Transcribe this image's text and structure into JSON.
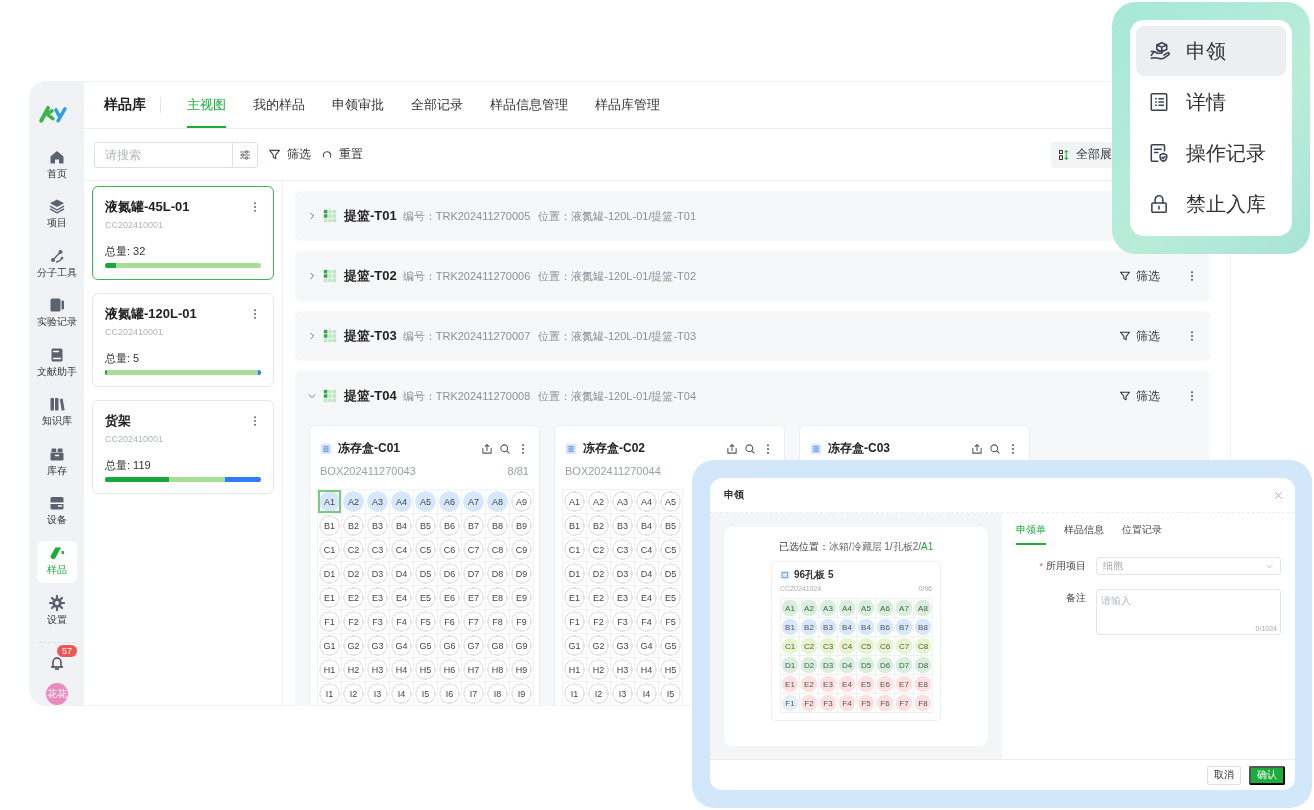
{
  "sidebar": {
    "items": [
      {
        "label": "首页",
        "selected": false
      },
      {
        "label": "项目",
        "selected": false
      },
      {
        "label": "分子工具",
        "selected": false
      },
      {
        "label": "实验记录",
        "selected": false
      },
      {
        "label": "文献助手",
        "selected": false
      },
      {
        "label": "知识库",
        "selected": false
      },
      {
        "label": "库存",
        "selected": false
      },
      {
        "label": "设备",
        "selected": false
      },
      {
        "label": "样品",
        "selected": true
      },
      {
        "label": "设置",
        "selected": false
      }
    ],
    "notification_count": "57",
    "avatar_text": "花花"
  },
  "header": {
    "title": "样品库",
    "tabs": [
      {
        "label": "主视图",
        "selected": true
      },
      {
        "label": "我的样品",
        "selected": false
      },
      {
        "label": "申领审批",
        "selected": false
      },
      {
        "label": "全部记录",
        "selected": false
      },
      {
        "label": "样品信息管理",
        "selected": false
      },
      {
        "label": "样品库管理",
        "selected": false
      }
    ]
  },
  "toolbar": {
    "search_placeholder": "请搜索",
    "filter_label": "筛选",
    "reset_label": "重置",
    "expand_all_label": "全部展"
  },
  "storage_units": [
    {
      "name": "液氮罐-45L-01",
      "code": "CC202410001",
      "total": "总量: 32",
      "selected": true,
      "bar": {
        "color": "#a7dd97",
        "fills": [
          {
            "level": 0.07,
            "color": "#19a83a"
          }
        ]
      }
    },
    {
      "name": "液氮罐-120L-01",
      "code": "CC202410001",
      "total": "总量: 5",
      "selected": false,
      "bar": {
        "color": "#2f7df6",
        "fills": [
          {
            "level": 0.98,
            "color": "#a7dd97"
          },
          {
            "level": 0.01,
            "color": "#19a83a"
          }
        ]
      }
    },
    {
      "name": "货架",
      "code": "CC202410001",
      "total": "总量: 119",
      "selected": false,
      "bar": {
        "color": "#2f7df6",
        "fills": [
          {
            "level": 0.77,
            "color": "#a7dd97"
          },
          {
            "level": 0.41,
            "color": "#19a83a"
          }
        ]
      }
    }
  ],
  "baskets": [
    {
      "name": "提篮-T01",
      "code": "编号：TRK202411270005",
      "location": "位置：液氮罐-120L-01/提篮-T01",
      "expanded": false
    },
    {
      "name": "提篮-T02",
      "code": "编号：TRK202411270006",
      "location": "位置：液氮罐-120L-01/提篮-T02",
      "expanded": false,
      "filter_label": "筛选"
    },
    {
      "name": "提篮-T03",
      "code": "编号：TRK202411270007",
      "location": "位置：液氮罐-120L-01/提篮-T03",
      "expanded": false,
      "filter_label": "筛选"
    },
    {
      "name": "提篮-T04",
      "code": "编号：TRK202411270008",
      "location": "位置：液氮罐-120L-01/提篮-T04",
      "expanded": true,
      "filter_label": "筛选",
      "boxes": [
        {
          "name": "冻存盒-C01",
          "code": "BOX202411270043",
          "count": "8/81",
          "rows": [
            [
              {
                "label": "A1",
                "occupied": true,
                "selected": true
              },
              {
                "label": "A2",
                "occupied": true,
                "selected": false
              },
              {
                "label": "A3",
                "occupied": true,
                "selected": false
              },
              {
                "label": "A4",
                "occupied": true,
                "selected": false
              },
              {
                "label": "A5",
                "occupied": true,
                "selected": false
              },
              {
                "label": "A6",
                "occupied": true,
                "selected": false
              },
              {
                "label": "A7",
                "occupied": true,
                "selected": false
              },
              {
                "label": "A8",
                "occupied": true,
                "selected": false
              },
              {
                "label": "A9",
                "occupied": false,
                "selected": false
              }
            ],
            [
              {
                "label": "B1",
                "occupied": false,
                "selected": false
              },
              {
                "label": "B2",
                "occupied": false,
                "selected": false
              },
              {
                "label": "B3",
                "occupied": false,
                "selected": false
              },
              {
                "label": "B4",
                "occupied": false,
                "selected": false
              },
              {
                "label": "B5",
                "occupied": false,
                "selected": false
              },
              {
                "label": "B6",
                "occupied": false,
                "selected": false
              },
              {
                "label": "B7",
                "occupied": false,
                "selected": false
              },
              {
                "label": "B8",
                "occupied": false,
                "selected": false
              },
              {
                "label": "B9",
                "occupied": false,
                "selected": false
              }
            ],
            [
              {
                "label": "C1",
                "occupied": false,
                "selected": false
              },
              {
                "label": "C2",
                "occupied": false,
                "selected": false
              },
              {
                "label": "C3",
                "occupied": false,
                "selected": false
              },
              {
                "label": "C4",
                "occupied": false,
                "selected": false
              },
              {
                "label": "C5",
                "occupied": false,
                "selected": false
              },
              {
                "label": "C6",
                "occupied": false,
                "selected": false
              },
              {
                "label": "C7",
                "occupied": false,
                "selected": false
              },
              {
                "label": "C8",
                "occupied": false,
                "selected": false
              },
              {
                "label": "C9",
                "occupied": false,
                "selected": false
              }
            ],
            [
              {
                "label": "D1",
                "occupied": false,
                "selected": false
              },
              {
                "label": "D2",
                "occupied": false,
                "selected": false
              },
              {
                "label": "D3",
                "occupied": false,
                "selected": false
              },
              {
                "label": "D4",
                "occupied": false,
                "selected": false
              },
              {
                "label": "D5",
                "occupied": false,
                "selected": false
              },
              {
                "label": "D6",
                "occupied": false,
                "selected": false
              },
              {
                "label": "D7",
                "occupied": false,
                "selected": false
              },
              {
                "label": "D8",
                "occupied": false,
                "selected": false
              },
              {
                "label": "D9",
                "occupied": false,
                "selected": false
              }
            ],
            [
              {
                "label": "E1",
                "occupied": false,
                "selected": false
              },
              {
                "label": "E2",
                "occupied": false,
                "selected": false
              },
              {
                "label": "E3",
                "occupied": false,
                "selected": false
              },
              {
                "label": "E4",
                "occupied": false,
                "selected": false
              },
              {
                "label": "E5",
                "occupied": false,
                "selected": false
              },
              {
                "label": "E6",
                "occupied": false,
                "selected": false
              },
              {
                "label": "E7",
                "occupied": false,
                "selected": false
              },
              {
                "label": "E8",
                "occupied": false,
                "selected": false
              },
              {
                "label": "E9",
                "occupied": false,
                "selected": false
              }
            ],
            [
              {
                "label": "F1",
                "occupied": false,
                "selected": false
              },
              {
                "label": "F2",
                "occupied": false,
                "selected": false
              },
              {
                "label": "F3",
                "occupied": false,
                "selected": false
              },
              {
                "label": "F4",
                "occupied": false,
                "selected": false
              },
              {
                "label": "F5",
                "occupied": false,
                "selected": false
              },
              {
                "label": "F6",
                "occupied": false,
                "selected": false
              },
              {
                "label": "F7",
                "occupied": false,
                "selected": false
              },
              {
                "label": "F8",
                "occupied": false,
                "selected": false
              },
              {
                "label": "F9",
                "occupied": false,
                "selected": false
              }
            ],
            [
              {
                "label": "G1",
                "occupied": false,
                "selected": false
              },
              {
                "label": "G2",
                "occupied": false,
                "selected": false
              },
              {
                "label": "G3",
                "occupied": false,
                "selected": false
              },
              {
                "label": "G4",
                "occupied": false,
                "selected": false
              },
              {
                "label": "G5",
                "occupied": false,
                "selected": false
              },
              {
                "label": "G6",
                "occupied": false,
                "selected": false
              },
              {
                "label": "G7",
                "occupied": false,
                "selected": false
              },
              {
                "label": "G8",
                "occupied": false,
                "selected": false
              },
              {
                "label": "G9",
                "occupied": false,
                "selected": false
              }
            ],
            [
              {
                "label": "H1",
                "occupied": false,
                "selected": false
              },
              {
                "label": "H2",
                "occupied": false,
                "selected": false
              },
              {
                "label": "H3",
                "occupied": false,
                "selected": false
              },
              {
                "label": "H4",
                "occupied": false,
                "selected": false
              },
              {
                "label": "H5",
                "occupied": false,
                "selected": false
              },
              {
                "label": "H6",
                "occupied": false,
                "selected": false
              },
              {
                "label": "H7",
                "occupied": false,
                "selected": false
              },
              {
                "label": "H8",
                "occupied": false,
                "selected": false
              },
              {
                "label": "H9",
                "occupied": false,
                "selected": false
              }
            ],
            [
              {
                "label": "I1",
                "occupied": false,
                "selected": false
              },
              {
                "label": "I2",
                "occupied": false,
                "selected": false
              },
              {
                "label": "I3",
                "occupied": false,
                "selected": false
              },
              {
                "label": "I4",
                "occupied": false,
                "selected": false
              },
              {
                "label": "I5",
                "occupied": false,
                "selected": false
              },
              {
                "label": "I6",
                "occupied": false,
                "selected": false
              },
              {
                "label": "I7",
                "occupied": false,
                "selected": false
              },
              {
                "label": "I8",
                "occupied": false,
                "selected": false
              },
              {
                "label": "I9",
                "occupied": false,
                "selected": false
              }
            ]
          ]
        },
        {
          "name": "冻存盒-C02",
          "code": "BOX202411270044",
          "rows": [
            [
              {
                "label": "A1",
                "occupied": false,
                "selected": false
              },
              {
                "label": "A2",
                "occupied": false,
                "selected": false
              },
              {
                "label": "A3",
                "occupied": false,
                "selected": false
              },
              {
                "label": "A4",
                "occupied": false,
                "selected": false
              },
              {
                "label": "A5",
                "occupied": false,
                "selected": false
              }
            ],
            [
              {
                "label": "B1",
                "occupied": false,
                "selected": false
              },
              {
                "label": "B2",
                "occupied": false,
                "selected": false
              },
              {
                "label": "B3",
                "occupied": false,
                "selected": false
              },
              {
                "label": "B4",
                "occupied": false,
                "selected": false
              },
              {
                "label": "B5",
                "occupied": false,
                "selected": false
              }
            ],
            [
              {
                "label": "C1",
                "occupied": false,
                "selected": false
              },
              {
                "label": "C2",
                "occupied": false,
                "selected": false
              },
              {
                "label": "C3",
                "occupied": false,
                "selected": false
              },
              {
                "label": "C4",
                "occupied": false,
                "selected": false
              },
              {
                "label": "C5",
                "occupied": false,
                "selected": false
              }
            ],
            [
              {
                "label": "D1",
                "occupied": false,
                "selected": false
              },
              {
                "label": "D2",
                "occupied": false,
                "selected": false
              },
              {
                "label": "D3",
                "occupied": false,
                "selected": false
              },
              {
                "label": "D4",
                "occupied": false,
                "selected": false
              },
              {
                "label": "D5",
                "occupied": false,
                "selected": false
              }
            ],
            [
              {
                "label": "E1",
                "occupied": false,
                "selected": false
              },
              {
                "label": "E2",
                "occupied": false,
                "selected": false
              },
              {
                "label": "E3",
                "occupied": false,
                "selected": false
              },
              {
                "label": "E4",
                "occupied": false,
                "selected": false
              },
              {
                "label": "E5",
                "occupied": false,
                "selected": false
              }
            ],
            [
              {
                "label": "F1",
                "occupied": false,
                "selected": false
              },
              {
                "label": "F2",
                "occupied": false,
                "selected": false
              },
              {
                "label": "F3",
                "occupied": false,
                "selected": false
              },
              {
                "label": "F4",
                "occupied": false,
                "selected": false
              },
              {
                "label": "F5",
                "occupied": false,
                "selected": false
              }
            ],
            [
              {
                "label": "G1",
                "occupied": false,
                "selected": false
              },
              {
                "label": "G2",
                "occupied": false,
                "selected": false
              },
              {
                "label": "G3",
                "occupied": false,
                "selected": false
              },
              {
                "label": "G4",
                "occupied": false,
                "selected": false
              },
              {
                "label": "G5",
                "occupied": false,
                "selected": false
              }
            ],
            [
              {
                "label": "H1",
                "occupied": false,
                "selected": false
              },
              {
                "label": "H2",
                "occupied": false,
                "selected": false
              },
              {
                "label": "H3",
                "occupied": false,
                "selected": false
              },
              {
                "label": "H4",
                "occupied": false,
                "selected": false
              },
              {
                "label": "H5",
                "occupied": false,
                "selected": false
              }
            ],
            [
              {
                "label": "I1",
                "occupied": false,
                "selected": false
              },
              {
                "label": "I2",
                "occupied": false,
                "selected": false
              },
              {
                "label": "I3",
                "occupied": false,
                "selected": false
              },
              {
                "label": "I4",
                "occupied": false,
                "selected": false
              },
              {
                "label": "I5",
                "occupied": false,
                "selected": false
              }
            ]
          ]
        },
        {
          "name": "冻存盒-C03"
        }
      ]
    }
  ],
  "context_menu": {
    "items": [
      {
        "label": "申领",
        "selected": true
      },
      {
        "label": "详情",
        "selected": false
      },
      {
        "label": "操作记录",
        "selected": false
      },
      {
        "label": "禁止入库",
        "selected": false
      }
    ]
  },
  "claim_dialog": {
    "title": "申领",
    "selected_location": {
      "label": "已选位置：",
      "path": "冰箱/冷藏层 1/孔板2/",
      "well": "A1"
    },
    "plate": {
      "name": "96孔板 5",
      "code": "CC20241024",
      "count": "0/96",
      "rows": [
        [
          {
            "label": "A1",
            "color": "#d6f0dc"
          },
          {
            "label": "A2",
            "color": "#d6f0dc"
          },
          {
            "label": "A3",
            "color": "#d6f0dc"
          },
          {
            "label": "A4",
            "color": "#d6f0dc"
          },
          {
            "label": "A5",
            "color": "#d6f0dc"
          },
          {
            "label": "A6",
            "color": "#d6f0dc"
          },
          {
            "label": "A7",
            "color": "#d6f0dc"
          },
          {
            "label": "A8",
            "color": "#d6f0dc"
          }
        ],
        [
          {
            "label": "B1",
            "color": "#d8e8fb"
          },
          {
            "label": "B2",
            "color": "#d8e8fb"
          },
          {
            "label": "B3",
            "color": "#d8e8fb"
          },
          {
            "label": "B4",
            "color": "#d8e8fb"
          },
          {
            "label": "B4",
            "color": "#d8e8fb"
          },
          {
            "label": "B6",
            "color": "#d8e8fb"
          },
          {
            "label": "B7",
            "color": "#d8e8fb"
          },
          {
            "label": "B8",
            "color": "#d8e8fb"
          }
        ],
        [
          {
            "label": "C1",
            "color": "#e6f5cc"
          },
          {
            "label": "C2",
            "color": "#e6f5cc"
          },
          {
            "label": "C3",
            "color": "#e6f5cc"
          },
          {
            "label": "C4",
            "color": "#e6f5cc"
          },
          {
            "label": "C5",
            "color": "#e6f5cc"
          },
          {
            "label": "C6",
            "color": "#e6f5cc"
          },
          {
            "label": "C7",
            "color": "#e6f5cc"
          },
          {
            "label": "C8",
            "color": "#e6f5cc"
          }
        ],
        [
          {
            "label": "D1",
            "color": "#d6f0dc"
          },
          {
            "label": "D2",
            "color": "#d6f0dc"
          },
          {
            "label": "D3",
            "color": "#d6f0dc"
          },
          {
            "label": "D4",
            "color": "#d6f0dc"
          },
          {
            "label": "D5",
            "color": "#d6f0dc"
          },
          {
            "label": "D6",
            "color": "#d6f0dc"
          },
          {
            "label": "D7",
            "color": "#d6f0dc"
          },
          {
            "label": "D8",
            "color": "#d6f0dc"
          }
        ],
        [
          {
            "label": "E1",
            "color": "#fde0e0"
          },
          {
            "label": "E2",
            "color": "#fde0e0"
          },
          {
            "label": "E3",
            "color": "#fde0e0"
          },
          {
            "label": "E4",
            "color": "#fde0e0"
          },
          {
            "label": "E5",
            "color": "#fde0e0"
          },
          {
            "label": "E6",
            "color": "#fde0e0"
          },
          {
            "label": "E7",
            "color": "#fde0e0"
          },
          {
            "label": "E8",
            "color": "#fde0e0"
          }
        ],
        [
          {
            "label": "F1",
            "color": "#e4effb"
          },
          {
            "label": "F2",
            "color": "#fde0e0"
          },
          {
            "label": "F3",
            "color": "#fde0e0"
          },
          {
            "label": "F4",
            "color": "#fde0e0"
          },
          {
            "label": "F5",
            "color": "#fde0e0"
          },
          {
            "label": "F6",
            "color": "#fde0e0"
          },
          {
            "label": "F7",
            "color": "#fde0e0"
          },
          {
            "label": "F8",
            "color": "#fde0e0"
          }
        ]
      ]
    },
    "tabs": [
      {
        "label": "申领单",
        "selected": true
      },
      {
        "label": "样品信息",
        "selected": false
      },
      {
        "label": "位置记录",
        "selected": false
      }
    ],
    "project_field": {
      "required_mark": "*",
      "label": "所用项目",
      "value": "细胞"
    },
    "note_field": {
      "label": "备注",
      "placeholder": "请输入",
      "counter": "0/1024"
    },
    "buttons": [
      {
        "label": "取消",
        "kind": "secondary"
      },
      {
        "label": "确认",
        "kind": "primary"
      }
    ]
  }
}
